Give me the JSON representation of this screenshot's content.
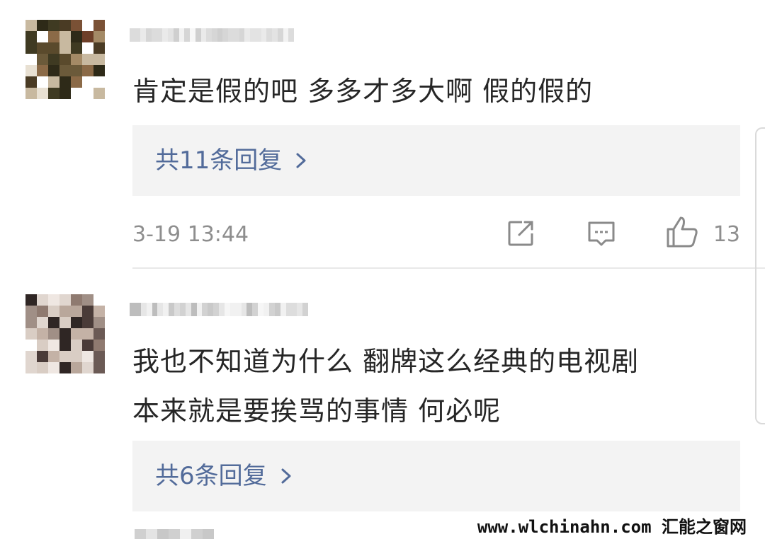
{
  "comments": [
    {
      "text_lines": [
        "肯定是假的吧 多多才多大啊 假的假的"
      ],
      "replies_label": "共11条回复",
      "timestamp": "3-19 13:44",
      "like_count": "13",
      "icons": [
        "share-icon",
        "comment-icon",
        "like-icon"
      ]
    },
    {
      "text_lines": [
        "我也不知道为什么 翻牌这么经典的电视剧",
        "本来就是要挨骂的事情 何必呢"
      ],
      "replies_label": "共6条回复"
    }
  ],
  "watermark": "www.wlchinahn.com 汇能之窗网",
  "colors": {
    "reply_link": "#526b9a",
    "reply_box_bg": "#f3f3f3",
    "meta_text": "#8e8e8e",
    "divider": "#e8e8e8"
  }
}
